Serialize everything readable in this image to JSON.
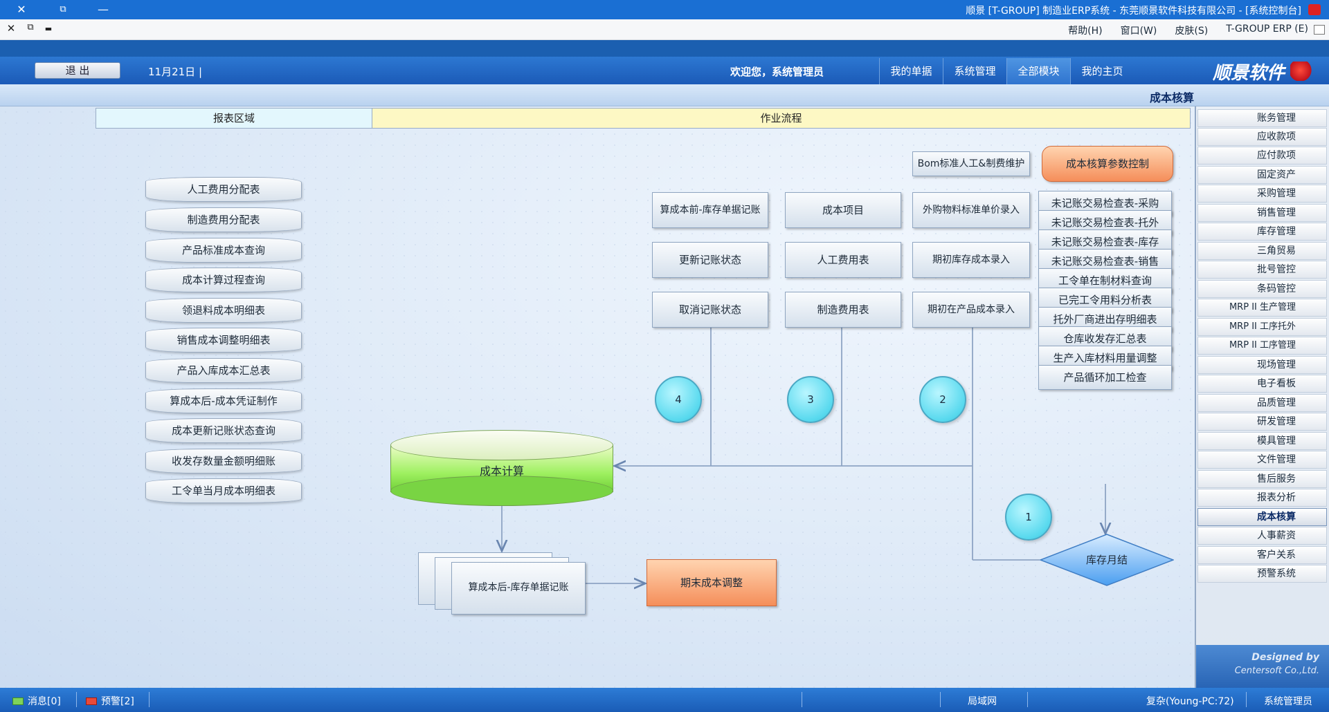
{
  "titlebar": {
    "title": "顺景 [T-GROUP] 制造业ERP系统 - 东莞顺景软件科技有限公司 - [系统控制台]",
    "controls": [
      "✕",
      "⧉",
      "—"
    ]
  },
  "menubar": {
    "items": [
      "T-GROUP ERP (E)",
      "皮肤(S)",
      "窗口(W)",
      "帮助(H)"
    ],
    "controls": [
      "✕",
      "⧉",
      "▬"
    ]
  },
  "nav": {
    "brand": "顺景软件",
    "tabs": [
      "我的主页",
      "全部模块",
      "系统管理",
      "我的单据"
    ],
    "active_tab": "全部模块",
    "welcome": "欢迎您，系统管理员",
    "date": "11月21日 |",
    "logout": "退 出"
  },
  "module_title": "成本核算",
  "zones": {
    "flow": "作业流程",
    "reports": "报表区域"
  },
  "sidebar": {
    "items": [
      "账务管理",
      "应收款项",
      "应付款项",
      "固定资产",
      "采购管理",
      "销售管理",
      "库存管理",
      "三角贸易",
      "批号管控",
      "条码管控",
      "MRP II 生产管理",
      "MRP II 工序托外",
      "MRP II 工序管理",
      "现场管理",
      "电子看板",
      "品质管理",
      "研发管理",
      "模具管理",
      "文件管理",
      "售后服务",
      "报表分析",
      "成本核算",
      "人事薪资",
      "客户关系",
      "预警系统"
    ],
    "active": "成本核算",
    "credit_line1": "Designed by",
    "credit_line2": "Centersoft Co.,Ltd."
  },
  "flow": {
    "control": "成本核算参数控制",
    "bom": "Bom标准人工&制费维护",
    "checks": [
      "未记账交易检查表-采购",
      "未记账交易检查表-托外",
      "未记账交易检查表-库存",
      "未记账交易检查表-销售",
      "工令单在制材料查询",
      "已完工令用料分析表",
      "托外厂商进出存明细表",
      "仓库收发存汇总表",
      "生产入库材料用量调整",
      "产品循环加工检查"
    ],
    "col2": [
      "外购物料标准单价录入",
      "期初库存成本录入",
      "期初在产品成本录入"
    ],
    "col3": [
      "成本项目",
      "人工费用表",
      "制造费用表"
    ],
    "col4": [
      "算成本前-库存单据记账",
      "更新记账状态",
      "取消记账状态"
    ],
    "bullets": [
      "1",
      "2",
      "3",
      "4"
    ],
    "calc": "成本计算",
    "month_end": "库存月结",
    "after_calc": "算成本后-库存单据记账",
    "period_adjust": "期末成本调整"
  },
  "reports": [
    "人工费用分配表",
    "制造费用分配表",
    "产品标准成本查询",
    "成本计算过程查询",
    "领退料成本明细表",
    "销售成本调整明细表",
    "产品入库成本汇总表",
    "算成本后-成本凭证制作",
    "成本更新记账状态查询",
    "收发存数量金额明细账",
    "工令单当月成本明细表"
  ],
  "statusbar": {
    "user": "系统管理员",
    "server": "复杂(Young-PC:72)",
    "network": "局域网",
    "alerts": "预警[2]",
    "messages": "消息[0]"
  },
  "colors": {
    "titlebar": "#1a6fd3",
    "nav": "#1b5ab7",
    "orange_box": "#f58e5a",
    "bullet": "#58d9ee",
    "month_end": "#4a9ef0",
    "calc_green": "#9ef060"
  }
}
